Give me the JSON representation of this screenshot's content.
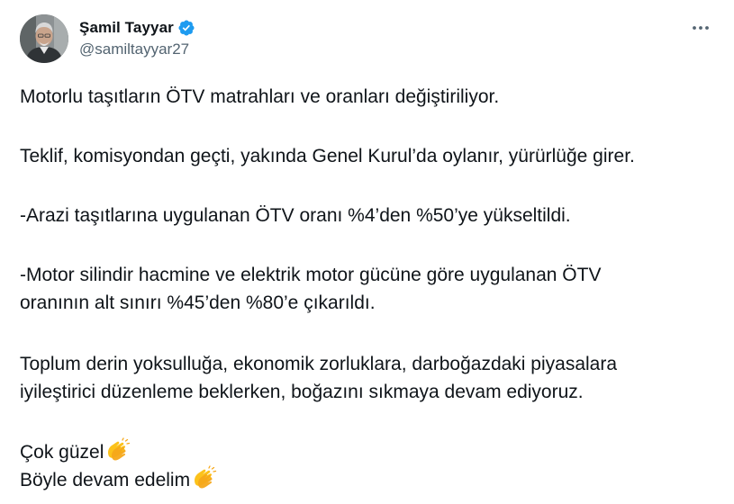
{
  "author": {
    "display_name": "Şamil Tayyar",
    "handle": "@samiltayyar27",
    "verified_icon": "verified-badge-icon",
    "avatar_description_icon": "avatar"
  },
  "menu": {
    "more_icon": "more-horizontal-icon"
  },
  "tweet": {
    "line1": "Motorlu taşıtların ÖTV matrahları ve oranları değiştiriliyor.",
    "line2": "Teklif, komisyondan geçti, yakında Genel Kurul’da oylanır, yürürlüğe girer.",
    "line3": "-Arazi taşıtlarına uygulanan ÖTV oranı %4’den %50’ye yükseltildi.",
    "line4a": "-Motor silindir hacmine ve elektrik motor gücüne göre uygulanan ÖTV",
    "line4b": "oranının alt sınırı %45’den %80’e çıkarıldı.",
    "line5a": "Toplum derin yoksulluğa, ekonomik zorluklara, darboğazdaki piyasalara",
    "line5b": "iyileştirici düzenleme beklerken, boğazını sıkmaya devam ediyoruz.",
    "line6": "Çok güzel",
    "line7": "Böyle devam edelim",
    "clap_icon": "clapping-hands-icon"
  },
  "colors": {
    "text": "#0f1419",
    "secondary": "#536471",
    "verified": "#1d9bf0",
    "background": "#ffffff"
  }
}
